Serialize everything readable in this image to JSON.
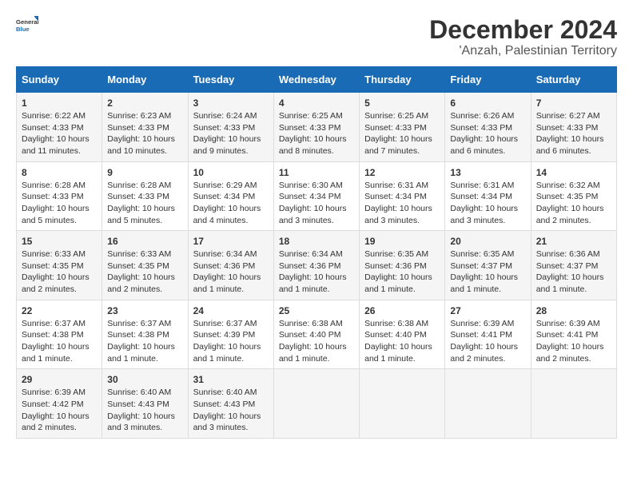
{
  "logo": {
    "line1": "General",
    "line2": "Blue"
  },
  "title": "December 2024",
  "subtitle": "'Anzah, Palestinian Territory",
  "days_header": [
    "Sunday",
    "Monday",
    "Tuesday",
    "Wednesday",
    "Thursday",
    "Friday",
    "Saturday"
  ],
  "weeks": [
    [
      {
        "day": "1",
        "text": "Sunrise: 6:22 AM\nSunset: 4:33 PM\nDaylight: 10 hours\nand 11 minutes."
      },
      {
        "day": "2",
        "text": "Sunrise: 6:23 AM\nSunset: 4:33 PM\nDaylight: 10 hours\nand 10 minutes."
      },
      {
        "day": "3",
        "text": "Sunrise: 6:24 AM\nSunset: 4:33 PM\nDaylight: 10 hours\nand 9 minutes."
      },
      {
        "day": "4",
        "text": "Sunrise: 6:25 AM\nSunset: 4:33 PM\nDaylight: 10 hours\nand 8 minutes."
      },
      {
        "day": "5",
        "text": "Sunrise: 6:25 AM\nSunset: 4:33 PM\nDaylight: 10 hours\nand 7 minutes."
      },
      {
        "day": "6",
        "text": "Sunrise: 6:26 AM\nSunset: 4:33 PM\nDaylight: 10 hours\nand 6 minutes."
      },
      {
        "day": "7",
        "text": "Sunrise: 6:27 AM\nSunset: 4:33 PM\nDaylight: 10 hours\nand 6 minutes."
      }
    ],
    [
      {
        "day": "8",
        "text": "Sunrise: 6:28 AM\nSunset: 4:33 PM\nDaylight: 10 hours\nand 5 minutes."
      },
      {
        "day": "9",
        "text": "Sunrise: 6:28 AM\nSunset: 4:33 PM\nDaylight: 10 hours\nand 5 minutes."
      },
      {
        "day": "10",
        "text": "Sunrise: 6:29 AM\nSunset: 4:34 PM\nDaylight: 10 hours\nand 4 minutes."
      },
      {
        "day": "11",
        "text": "Sunrise: 6:30 AM\nSunset: 4:34 PM\nDaylight: 10 hours\nand 3 minutes."
      },
      {
        "day": "12",
        "text": "Sunrise: 6:31 AM\nSunset: 4:34 PM\nDaylight: 10 hours\nand 3 minutes."
      },
      {
        "day": "13",
        "text": "Sunrise: 6:31 AM\nSunset: 4:34 PM\nDaylight: 10 hours\nand 3 minutes."
      },
      {
        "day": "14",
        "text": "Sunrise: 6:32 AM\nSunset: 4:35 PM\nDaylight: 10 hours\nand 2 minutes."
      }
    ],
    [
      {
        "day": "15",
        "text": "Sunrise: 6:33 AM\nSunset: 4:35 PM\nDaylight: 10 hours\nand 2 minutes."
      },
      {
        "day": "16",
        "text": "Sunrise: 6:33 AM\nSunset: 4:35 PM\nDaylight: 10 hours\nand 2 minutes."
      },
      {
        "day": "17",
        "text": "Sunrise: 6:34 AM\nSunset: 4:36 PM\nDaylight: 10 hours\nand 1 minute."
      },
      {
        "day": "18",
        "text": "Sunrise: 6:34 AM\nSunset: 4:36 PM\nDaylight: 10 hours\nand 1 minute."
      },
      {
        "day": "19",
        "text": "Sunrise: 6:35 AM\nSunset: 4:36 PM\nDaylight: 10 hours\nand 1 minute."
      },
      {
        "day": "20",
        "text": "Sunrise: 6:35 AM\nSunset: 4:37 PM\nDaylight: 10 hours\nand 1 minute."
      },
      {
        "day": "21",
        "text": "Sunrise: 6:36 AM\nSunset: 4:37 PM\nDaylight: 10 hours\nand 1 minute."
      }
    ],
    [
      {
        "day": "22",
        "text": "Sunrise: 6:37 AM\nSunset: 4:38 PM\nDaylight: 10 hours\nand 1 minute."
      },
      {
        "day": "23",
        "text": "Sunrise: 6:37 AM\nSunset: 4:38 PM\nDaylight: 10 hours\nand 1 minute."
      },
      {
        "day": "24",
        "text": "Sunrise: 6:37 AM\nSunset: 4:39 PM\nDaylight: 10 hours\nand 1 minute."
      },
      {
        "day": "25",
        "text": "Sunrise: 6:38 AM\nSunset: 4:40 PM\nDaylight: 10 hours\nand 1 minute."
      },
      {
        "day": "26",
        "text": "Sunrise: 6:38 AM\nSunset: 4:40 PM\nDaylight: 10 hours\nand 1 minute."
      },
      {
        "day": "27",
        "text": "Sunrise: 6:39 AM\nSunset: 4:41 PM\nDaylight: 10 hours\nand 2 minutes."
      },
      {
        "day": "28",
        "text": "Sunrise: 6:39 AM\nSunset: 4:41 PM\nDaylight: 10 hours\nand 2 minutes."
      }
    ],
    [
      {
        "day": "29",
        "text": "Sunrise: 6:39 AM\nSunset: 4:42 PM\nDaylight: 10 hours\nand 2 minutes."
      },
      {
        "day": "30",
        "text": "Sunrise: 6:40 AM\nSunset: 4:43 PM\nDaylight: 10 hours\nand 3 minutes."
      },
      {
        "day": "31",
        "text": "Sunrise: 6:40 AM\nSunset: 4:43 PM\nDaylight: 10 hours\nand 3 minutes."
      },
      {
        "day": "",
        "text": ""
      },
      {
        "day": "",
        "text": ""
      },
      {
        "day": "",
        "text": ""
      },
      {
        "day": "",
        "text": ""
      }
    ]
  ]
}
